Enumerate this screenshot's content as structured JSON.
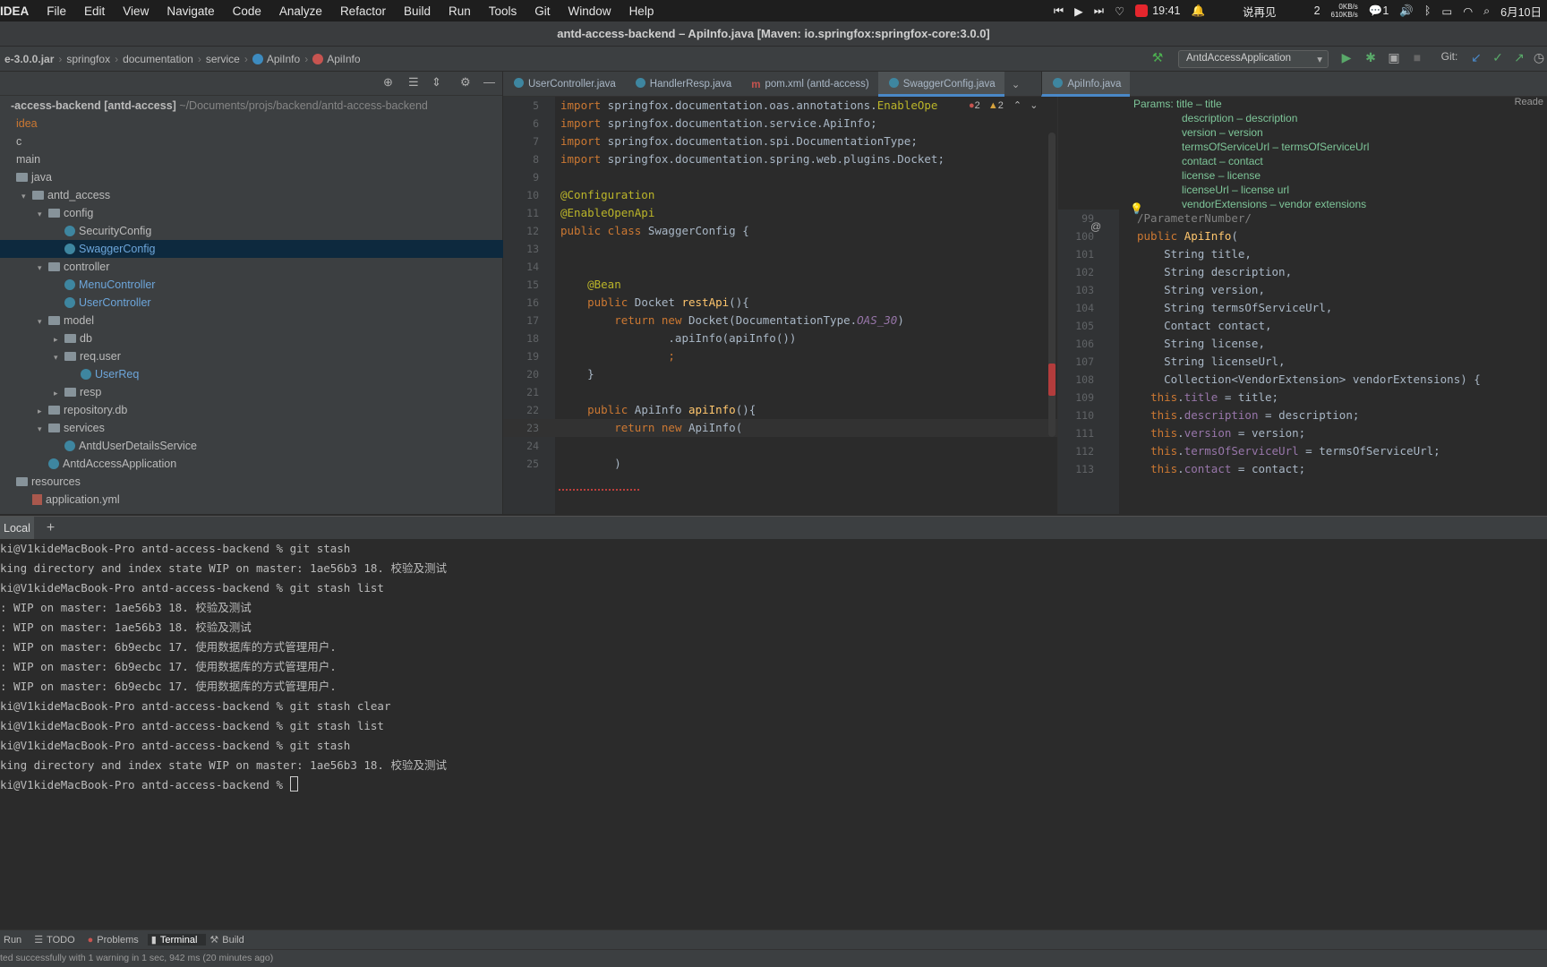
{
  "menubar": {
    "app_name": "IDEA",
    "items": [
      "File",
      "Edit",
      "View",
      "Navigate",
      "Code",
      "Analyze",
      "Refactor",
      "Build",
      "Run",
      "Tools",
      "Git",
      "Window",
      "Help"
    ],
    "recording_time": "19:41",
    "ime_text": "说再见",
    "badge_count": "2",
    "net_speed_up": "0KB/s",
    "net_speed_down": "610KB/s",
    "wechat_count": "1",
    "date": "6月10日"
  },
  "window": {
    "title": "antd-access-backend – ApiInfo.java [Maven: io.springfox:springfox-core:3.0.0]"
  },
  "navbar": {
    "crumbs": [
      "e-3.0.0.jar",
      "springfox",
      "documentation",
      "service",
      "ApiInfo",
      "ApiInfo"
    ],
    "run_config": "AntdAccessApplication",
    "git_label": "Git:"
  },
  "project_tree": [
    {
      "label": "-access-backend [antd-access]",
      "extra": "~/Documents/projs/backend/antd-access-backend",
      "indent": 0,
      "type": "root"
    },
    {
      "label": "idea",
      "indent": 0,
      "type": "orange"
    },
    {
      "label": "c",
      "indent": 0,
      "type": "plain"
    },
    {
      "label": "main",
      "indent": 0,
      "type": "plain"
    },
    {
      "label": "java",
      "indent": 0,
      "type": "folder"
    },
    {
      "label": "antd_access",
      "indent": 1,
      "type": "folder",
      "arrow": "v"
    },
    {
      "label": "config",
      "indent": 2,
      "type": "folder",
      "arrow": "v"
    },
    {
      "label": "SecurityConfig",
      "indent": 3,
      "type": "class"
    },
    {
      "label": "SwaggerConfig",
      "indent": 3,
      "type": "class",
      "selected": true
    },
    {
      "label": "controller",
      "indent": 2,
      "type": "folder",
      "arrow": "v"
    },
    {
      "label": "MenuController",
      "indent": 3,
      "type": "class-blue"
    },
    {
      "label": "UserController",
      "indent": 3,
      "type": "class-blue"
    },
    {
      "label": "model",
      "indent": 2,
      "type": "folder",
      "arrow": "v"
    },
    {
      "label": "db",
      "indent": 3,
      "type": "folder",
      "arrow": ">"
    },
    {
      "label": "req.user",
      "indent": 3,
      "type": "folder",
      "arrow": "v"
    },
    {
      "label": "UserReq",
      "indent": 4,
      "type": "class-blue"
    },
    {
      "label": "resp",
      "indent": 3,
      "type": "folder",
      "arrow": ">"
    },
    {
      "label": "repository.db",
      "indent": 2,
      "type": "folder",
      "arrow": ">"
    },
    {
      "label": "services",
      "indent": 2,
      "type": "folder",
      "arrow": "v"
    },
    {
      "label": "AntdUserDetailsService",
      "indent": 3,
      "type": "class"
    },
    {
      "label": "AntdAccessApplication",
      "indent": 2,
      "type": "class"
    },
    {
      "label": "resources",
      "indent": 0,
      "type": "folder"
    },
    {
      "label": "application.yml",
      "indent": 1,
      "type": "yml"
    }
  ],
  "editor_tabs": [
    {
      "label": "UserController.java",
      "icon": "class"
    },
    {
      "label": "HandlerResp.java",
      "icon": "class"
    },
    {
      "label": "pom.xml (antd-access)",
      "icon": "maven"
    },
    {
      "label": "SwaggerConfig.java",
      "icon": "class",
      "active": true
    },
    {
      "label": "ApiInfo.java",
      "icon": "class",
      "active2": true
    }
  ],
  "left_editor": {
    "errors": "2",
    "warnings": "2",
    "lines": [
      {
        "n": "5",
        "html": "<span class='kw'>import</span> springfox.documentation.oas.annotations.<span class='an'>EnableOpe</span>"
      },
      {
        "n": "6",
        "html": "<span class='kw'>import</span> springfox.documentation.service.ApiInfo;"
      },
      {
        "n": "7",
        "html": "<span class='kw'>import</span> springfox.documentation.spi.DocumentationType;"
      },
      {
        "n": "8",
        "html": "<span class='kw'>import</span> springfox.documentation.spring.web.plugins.Docket;"
      },
      {
        "n": "9",
        "html": ""
      },
      {
        "n": "10",
        "html": "<span class='an'>@Configuration</span>"
      },
      {
        "n": "11",
        "html": "<span class='an'>@EnableOpenApi</span>"
      },
      {
        "n": "12",
        "html": "<span class='kw'>public class</span> SwaggerConfig {"
      },
      {
        "n": "13",
        "html": ""
      },
      {
        "n": "14",
        "html": ""
      },
      {
        "n": "15",
        "html": "    <span class='an'>@Bean</span>"
      },
      {
        "n": "16",
        "html": "    <span class='kw'>public</span> Docket <span class='fn'>restApi</span>(){"
      },
      {
        "n": "17",
        "html": "        <span class='kw'>return new</span> Docket(DocumentationType.<span class='it'>OAS_30</span>)"
      },
      {
        "n": "18",
        "html": "                .apiInfo(apiInfo())"
      },
      {
        "n": "19",
        "html": "                <span class='kw'>;</span>"
      },
      {
        "n": "20",
        "html": "    }"
      },
      {
        "n": "21",
        "html": ""
      },
      {
        "n": "22",
        "html": "    <span class='kw'>public</span> ApiInfo <span class='fn'>apiInfo</span>(){"
      },
      {
        "n": "23",
        "html": "        <span class='kw'>return new</span> ApiInfo(",
        "current": true
      },
      {
        "n": "24",
        "html": ""
      },
      {
        "n": "25",
        "html": "        )"
      }
    ]
  },
  "right_editor": {
    "reader_label": "Reade",
    "doc": [
      "Params: title – title",
      "description – description",
      "version – version",
      "termsOfServiceUrl – termsOfServiceUrl",
      "contact – contact",
      "license – license",
      "licenseUrl – license url",
      "vendorExtensions – vendor extensions"
    ],
    "lines": [
      {
        "n": "99",
        "html": "<span style='color:#808080'>/ParameterNumber/</span>"
      },
      {
        "n": "100",
        "html": "<span class='kw'>public</span> <span class='fn'>ApiInfo</span>("
      },
      {
        "n": "101",
        "html": "    String title,"
      },
      {
        "n": "102",
        "html": "    String description,"
      },
      {
        "n": "103",
        "html": "    String version,"
      },
      {
        "n": "104",
        "html": "    String termsOfServiceUrl,"
      },
      {
        "n": "105",
        "html": "    Contact contact,"
      },
      {
        "n": "106",
        "html": "    String license,"
      },
      {
        "n": "107",
        "html": "    String licenseUrl,"
      },
      {
        "n": "108",
        "html": "    Collection&lt;VendorExtension&gt; vendorExtensions) {"
      },
      {
        "n": "109",
        "html": "  <span class='kw'>this</span>.<span class='fld'>title</span> = title;"
      },
      {
        "n": "110",
        "html": "  <span class='kw'>this</span>.<span class='fld'>description</span> = description;"
      },
      {
        "n": "111",
        "html": "  <span class='kw'>this</span>.<span class='fld'>version</span> = version;"
      },
      {
        "n": "112",
        "html": "  <span class='kw'>this</span>.<span class='fld'>termsOfServiceUrl</span> = termsOfServiceUrl;"
      },
      {
        "n": "113",
        "html": "  <span class='kw'>this</span>.<span class='fld'>contact</span> = contact;"
      }
    ]
  },
  "terminal": {
    "tab_label": "Local",
    "add_label": "+",
    "lines": [
      "ki@V1kideMacBook-Pro antd-access-backend % git stash",
      "king directory and index state WIP on master: 1ae56b3 18. 校验及测试",
      "ki@V1kideMacBook-Pro antd-access-backend % git stash list",
      ": WIP on master: 1ae56b3 18. 校验及测试",
      ": WIP on master: 1ae56b3 18. 校验及测试",
      ": WIP on master: 6b9ecbc 17. 使用数据库的方式管理用户.",
      ": WIP on master: 6b9ecbc 17. 使用数据库的方式管理用户.",
      ": WIP on master: 6b9ecbc 17. 使用数据库的方式管理用户.",
      "ki@V1kideMacBook-Pro antd-access-backend % git stash clear",
      "ki@V1kideMacBook-Pro antd-access-backend % git stash list",
      "ki@V1kideMacBook-Pro antd-access-backend % git stash",
      "king directory and index state WIP on master: 1ae56b3 18. 校验及测试",
      "ki@V1kideMacBook-Pro antd-access-backend % "
    ]
  },
  "bottom_tools": [
    "Run",
    "TODO",
    "Problems",
    "Terminal",
    "Build"
  ],
  "status": "ted successfully with 1 warning in 1 sec, 942 ms (20 minutes ago)"
}
